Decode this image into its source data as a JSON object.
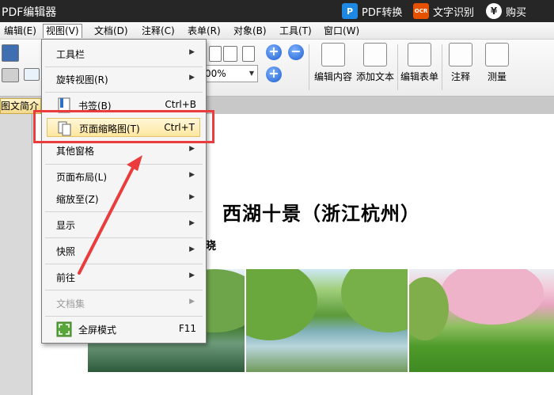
{
  "titlebar": {
    "app_title": "PDF编辑器",
    "pdf_convert": "PDF转换",
    "ocr_icon": "OCR",
    "ocr": "文字识别",
    "buy_icon": "¥",
    "buy": "购买"
  },
  "menubar": {
    "items": [
      "编辑(E)",
      "视图(V)",
      "文档(D)",
      "注释(C)",
      "表单(R)",
      "对象(B)",
      "工具(T)",
      "窗口(W)"
    ]
  },
  "toolbar": {
    "zoom_value": "00%",
    "edit_content": "编辑内容",
    "add_text": "添加文本",
    "edit_form": "编辑表单",
    "annotate": "注释",
    "measure": "测量"
  },
  "left_tab": "图文简介",
  "dropdown": {
    "items": [
      {
        "label": "工具栏",
        "submenu": true
      },
      {
        "label": "旋转视图(R)",
        "submenu": true
      },
      {
        "label": "书签(B)",
        "shortcut": "Ctrl+B",
        "icon": "bookmark-icon"
      },
      {
        "label": "页面缩略图(T)",
        "shortcut": "Ctrl+T",
        "icon": "thumbnail-icon",
        "highlighted": true
      },
      {
        "label": "其他窗格",
        "submenu": true
      },
      {
        "label": "页面布局(L)",
        "submenu": true
      },
      {
        "label": "缩放至(Z)",
        "submenu": true
      },
      {
        "label": "显示",
        "submenu": true
      },
      {
        "label": "快照",
        "submenu": true
      },
      {
        "label": "前往",
        "submenu": true
      },
      {
        "label": "文档集",
        "submenu": true,
        "disabled": true
      },
      {
        "label": "全屏模式",
        "shortcut": "F11",
        "icon": "fullscreen-icon"
      }
    ]
  },
  "document": {
    "title": "西湖十景（浙江杭州）",
    "subtitle": "晓"
  },
  "colors": {
    "annotation": "#ea3c3c",
    "highlight": "#ffe7a0",
    "titlebar": "#262626"
  }
}
